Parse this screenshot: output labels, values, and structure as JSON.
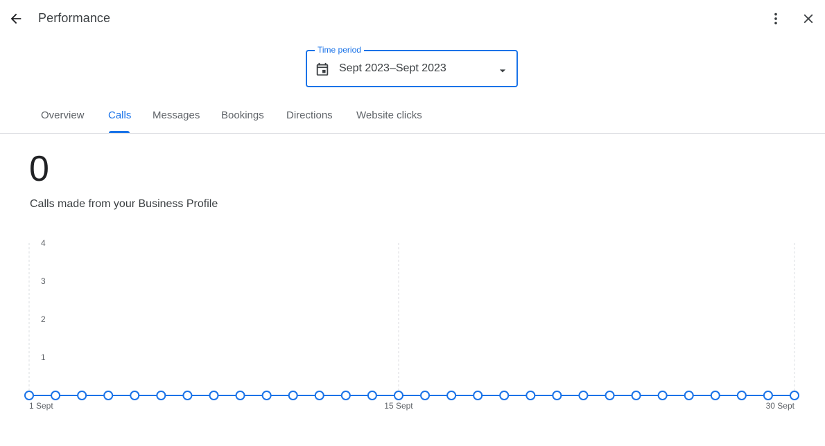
{
  "header": {
    "title": "Performance",
    "back_icon": "arrow-back-icon",
    "more_icon": "more-vert-icon",
    "close_icon": "close-icon"
  },
  "time_period": {
    "label": "Time period",
    "value": "Sept 2023–Sept 2023",
    "icon": "calendar-icon"
  },
  "tabs": [
    {
      "label": "Overview",
      "active": false
    },
    {
      "label": "Calls",
      "active": true
    },
    {
      "label": "Messages",
      "active": false
    },
    {
      "label": "Bookings",
      "active": false
    },
    {
      "label": "Directions",
      "active": false
    },
    {
      "label": "Website clicks",
      "active": false
    }
  ],
  "summary": {
    "count": "0",
    "label": "Calls made from your Business Profile"
  },
  "colors": {
    "accent": "#1a73e8"
  },
  "chart_data": {
    "type": "line",
    "x": [
      1,
      2,
      3,
      4,
      5,
      6,
      7,
      8,
      9,
      10,
      11,
      12,
      13,
      14,
      15,
      16,
      17,
      18,
      19,
      20,
      21,
      22,
      23,
      24,
      25,
      26,
      27,
      28,
      29,
      30
    ],
    "series": [
      {
        "values": [
          0,
          0,
          0,
          0,
          0,
          0,
          0,
          0,
          0,
          0,
          0,
          0,
          0,
          0,
          0,
          0,
          0,
          0,
          0,
          0,
          0,
          0,
          0,
          0,
          0,
          0,
          0,
          0,
          0,
          0
        ]
      }
    ],
    "xtick_labels": [
      {
        "x": 1,
        "label": "1 Sept"
      },
      {
        "x": 15,
        "label": "15 Sept"
      },
      {
        "x": 30,
        "label": "30 Sept"
      }
    ],
    "yticks": [
      "1",
      "2",
      "3",
      "4"
    ],
    "ylim": [
      0,
      4
    ],
    "xlim": [
      1,
      30
    ],
    "grid": "vertical dashed at 1, 15, 30"
  }
}
